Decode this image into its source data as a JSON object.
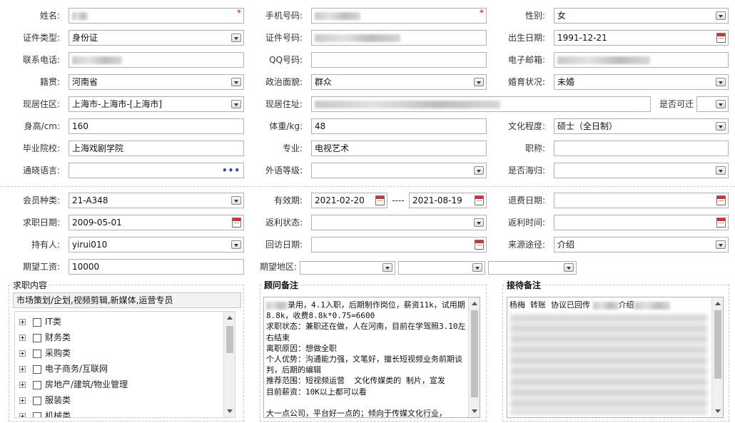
{
  "fields": {
    "name": {
      "label": "姓名:"
    },
    "mobile": {
      "label": "手机号码:"
    },
    "gender": {
      "label": "性别:",
      "value": "女"
    },
    "id_type": {
      "label": "证件类型:",
      "value": "身份证"
    },
    "id_number": {
      "label": "证件号码:"
    },
    "birth_date": {
      "label": "出生日期:",
      "value": "1991-12-21"
    },
    "phone": {
      "label": "联系电话:"
    },
    "qq": {
      "label": "QQ号码:"
    },
    "email": {
      "label": "电子邮箱:"
    },
    "native_place": {
      "label": "籍贯:",
      "value": "河南省"
    },
    "political": {
      "label": "政治面貌:",
      "value": "群众"
    },
    "marital": {
      "label": "婚育状况:",
      "value": "未婚"
    },
    "residence_area": {
      "label": "现居住区:",
      "value": "上海市-上海市-[上海市]"
    },
    "residence_addr": {
      "label": "现居住址:"
    },
    "relocatable": {
      "label": "是否可迁"
    },
    "height": {
      "label": "身高/cm:",
      "value": "160"
    },
    "weight": {
      "label": "体重/kg:",
      "value": "48"
    },
    "education": {
      "label": "文化程度:",
      "value": "硕士（全日制）"
    },
    "school": {
      "label": "毕业院校:",
      "value": "上海戏剧学院"
    },
    "major": {
      "label": "专业:",
      "value": "电视艺术"
    },
    "title": {
      "label": "职称:",
      "value": ""
    },
    "languages": {
      "label": "通晓语言:",
      "value": ""
    },
    "foreign_level": {
      "label": "外语等级:",
      "value": ""
    },
    "overseas": {
      "label": "是否海归:",
      "value": ""
    },
    "member_type": {
      "label": "会员种类:",
      "value": "21-A348"
    },
    "valid_period": {
      "label": "有效期:",
      "start": "2021-02-20",
      "sep": "----",
      "end": "2021-08-19"
    },
    "refund_date": {
      "label": "退费日期:",
      "value": ""
    },
    "job_seek_date": {
      "label": "求职日期:",
      "value": "2009-05-01"
    },
    "rebate_status": {
      "label": "返利状态:",
      "value": ""
    },
    "rebate_time": {
      "label": "返利时间:",
      "value": ""
    },
    "holder": {
      "label": "持有人:",
      "value": "yirui010"
    },
    "revisit_date": {
      "label": "回访日期:",
      "value": ""
    },
    "source": {
      "label": "来源途径:",
      "value": "介绍"
    },
    "expected_salary": {
      "label": "期望工资:",
      "value": "10000"
    },
    "expected_area": {
      "label": "期望地区:"
    }
  },
  "job_panel": {
    "title": "求职内容",
    "summary": "市场策划/企划,视频剪辑,新媒体,运营专员",
    "tree": [
      "IT类",
      "财务类",
      "采购类",
      "电子商务/互联网",
      "房地产/建筑/物业管理",
      "服装类",
      "机械类"
    ]
  },
  "advisor_panel": {
    "title": "顾问备注",
    "text": "录用，4.1入职，后期制作岗位，薪资11k，试用期8.8k，收费8.8k*0.75=6600\n求职状态：兼职还在做，人在河南，目前在学驾照3.10左右结束\n离职原因：想做全职\n个人优势：沟通能力强，文笔好，擅长短视频业务前期谈判，后期的编辑\n推荐范围：短视频运营  文化传媒类的 制片，宣发\n目前薪资：10K以上都可以看\n\n大一点公司，平台好一点的；倾向于传媒文化行业，"
  },
  "reception_panel": {
    "title": "接待备注",
    "text": "杨梅  转账  协议已回传"
  },
  "reception_intro": "介绍"
}
